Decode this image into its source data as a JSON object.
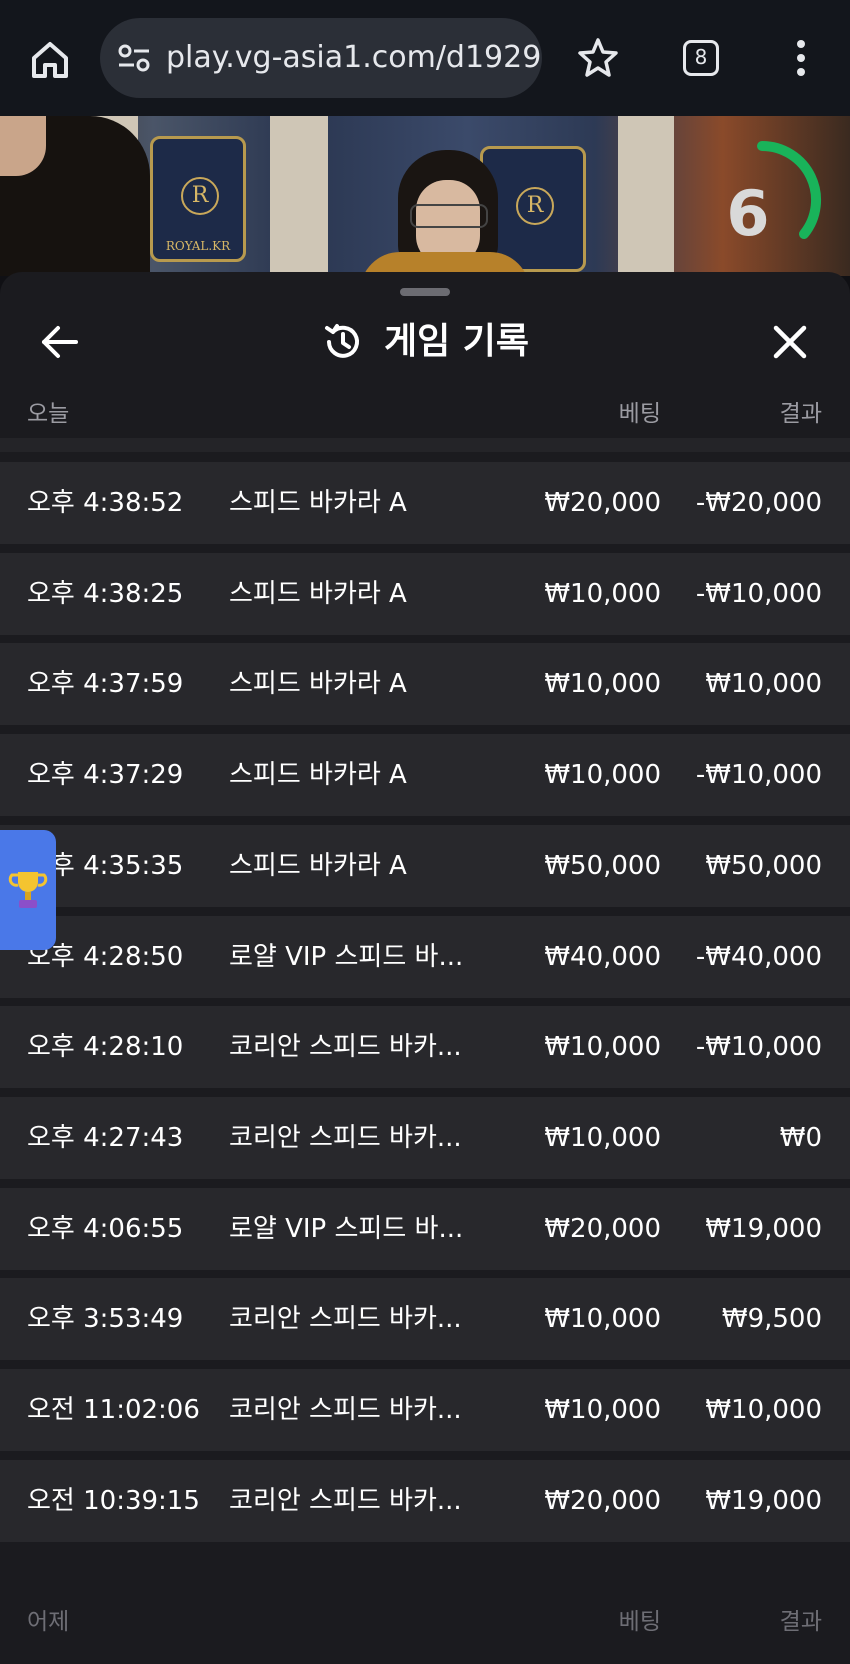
{
  "browser": {
    "url": "play.vg-asia1.com/d1929",
    "tab_count": "8"
  },
  "video": {
    "timer_value": "6",
    "emblem_text": "ROYAL.KR"
  },
  "history": {
    "title": "게임 기록",
    "today_section": {
      "label": "오늘",
      "bet_header": "베팅",
      "result_header": "결과"
    },
    "rows": [
      {
        "time": "오후 4:38:52",
        "game": "스피드 바카라 A",
        "bet": "₩20,000",
        "result": "-₩20,000"
      },
      {
        "time": "오후 4:38:25",
        "game": "스피드 바카라 A",
        "bet": "₩10,000",
        "result": "-₩10,000"
      },
      {
        "time": "오후 4:37:59",
        "game": "스피드 바카라 A",
        "bet": "₩10,000",
        "result": "₩10,000"
      },
      {
        "time": "오후 4:37:29",
        "game": "스피드 바카라 A",
        "bet": "₩10,000",
        "result": "-₩10,000"
      },
      {
        "time": "오후 4:35:35",
        "game": "스피드 바카라 A",
        "bet": "₩50,000",
        "result": "₩50,000"
      },
      {
        "time": "오후 4:28:50",
        "game": "로얄 VIP 스피드 바...",
        "bet": "₩40,000",
        "result": "-₩40,000"
      },
      {
        "time": "오후 4:28:10",
        "game": "코리안 스피드 바카...",
        "bet": "₩10,000",
        "result": "-₩10,000"
      },
      {
        "time": "오후 4:27:43",
        "game": "코리안 스피드 바카...",
        "bet": "₩10,000",
        "result": "₩0"
      },
      {
        "time": "오후 4:06:55",
        "game": "로얄 VIP 스피드 바...",
        "bet": "₩20,000",
        "result": "₩19,000"
      },
      {
        "time": "오후 3:53:49",
        "game": "코리안 스피드 바카...",
        "bet": "₩10,000",
        "result": "₩9,500"
      },
      {
        "time": "오전 11:02:06",
        "game": "코리안 스피드 바카...",
        "bet": "₩10,000",
        "result": "₩10,000"
      },
      {
        "time": "오전 10:39:15",
        "game": "코리안 스피드 바카...",
        "bet": "₩20,000",
        "result": "₩19,000"
      }
    ],
    "yesterday_section": {
      "label": "어제",
      "bet_header": "베팅",
      "result_header": "결과"
    }
  },
  "colors": {
    "sheet_bg": "#1b1b1f",
    "row_bg": "#28282c",
    "timer_ring": "#19b35a",
    "trophy_tab": "#4a78e8"
  }
}
